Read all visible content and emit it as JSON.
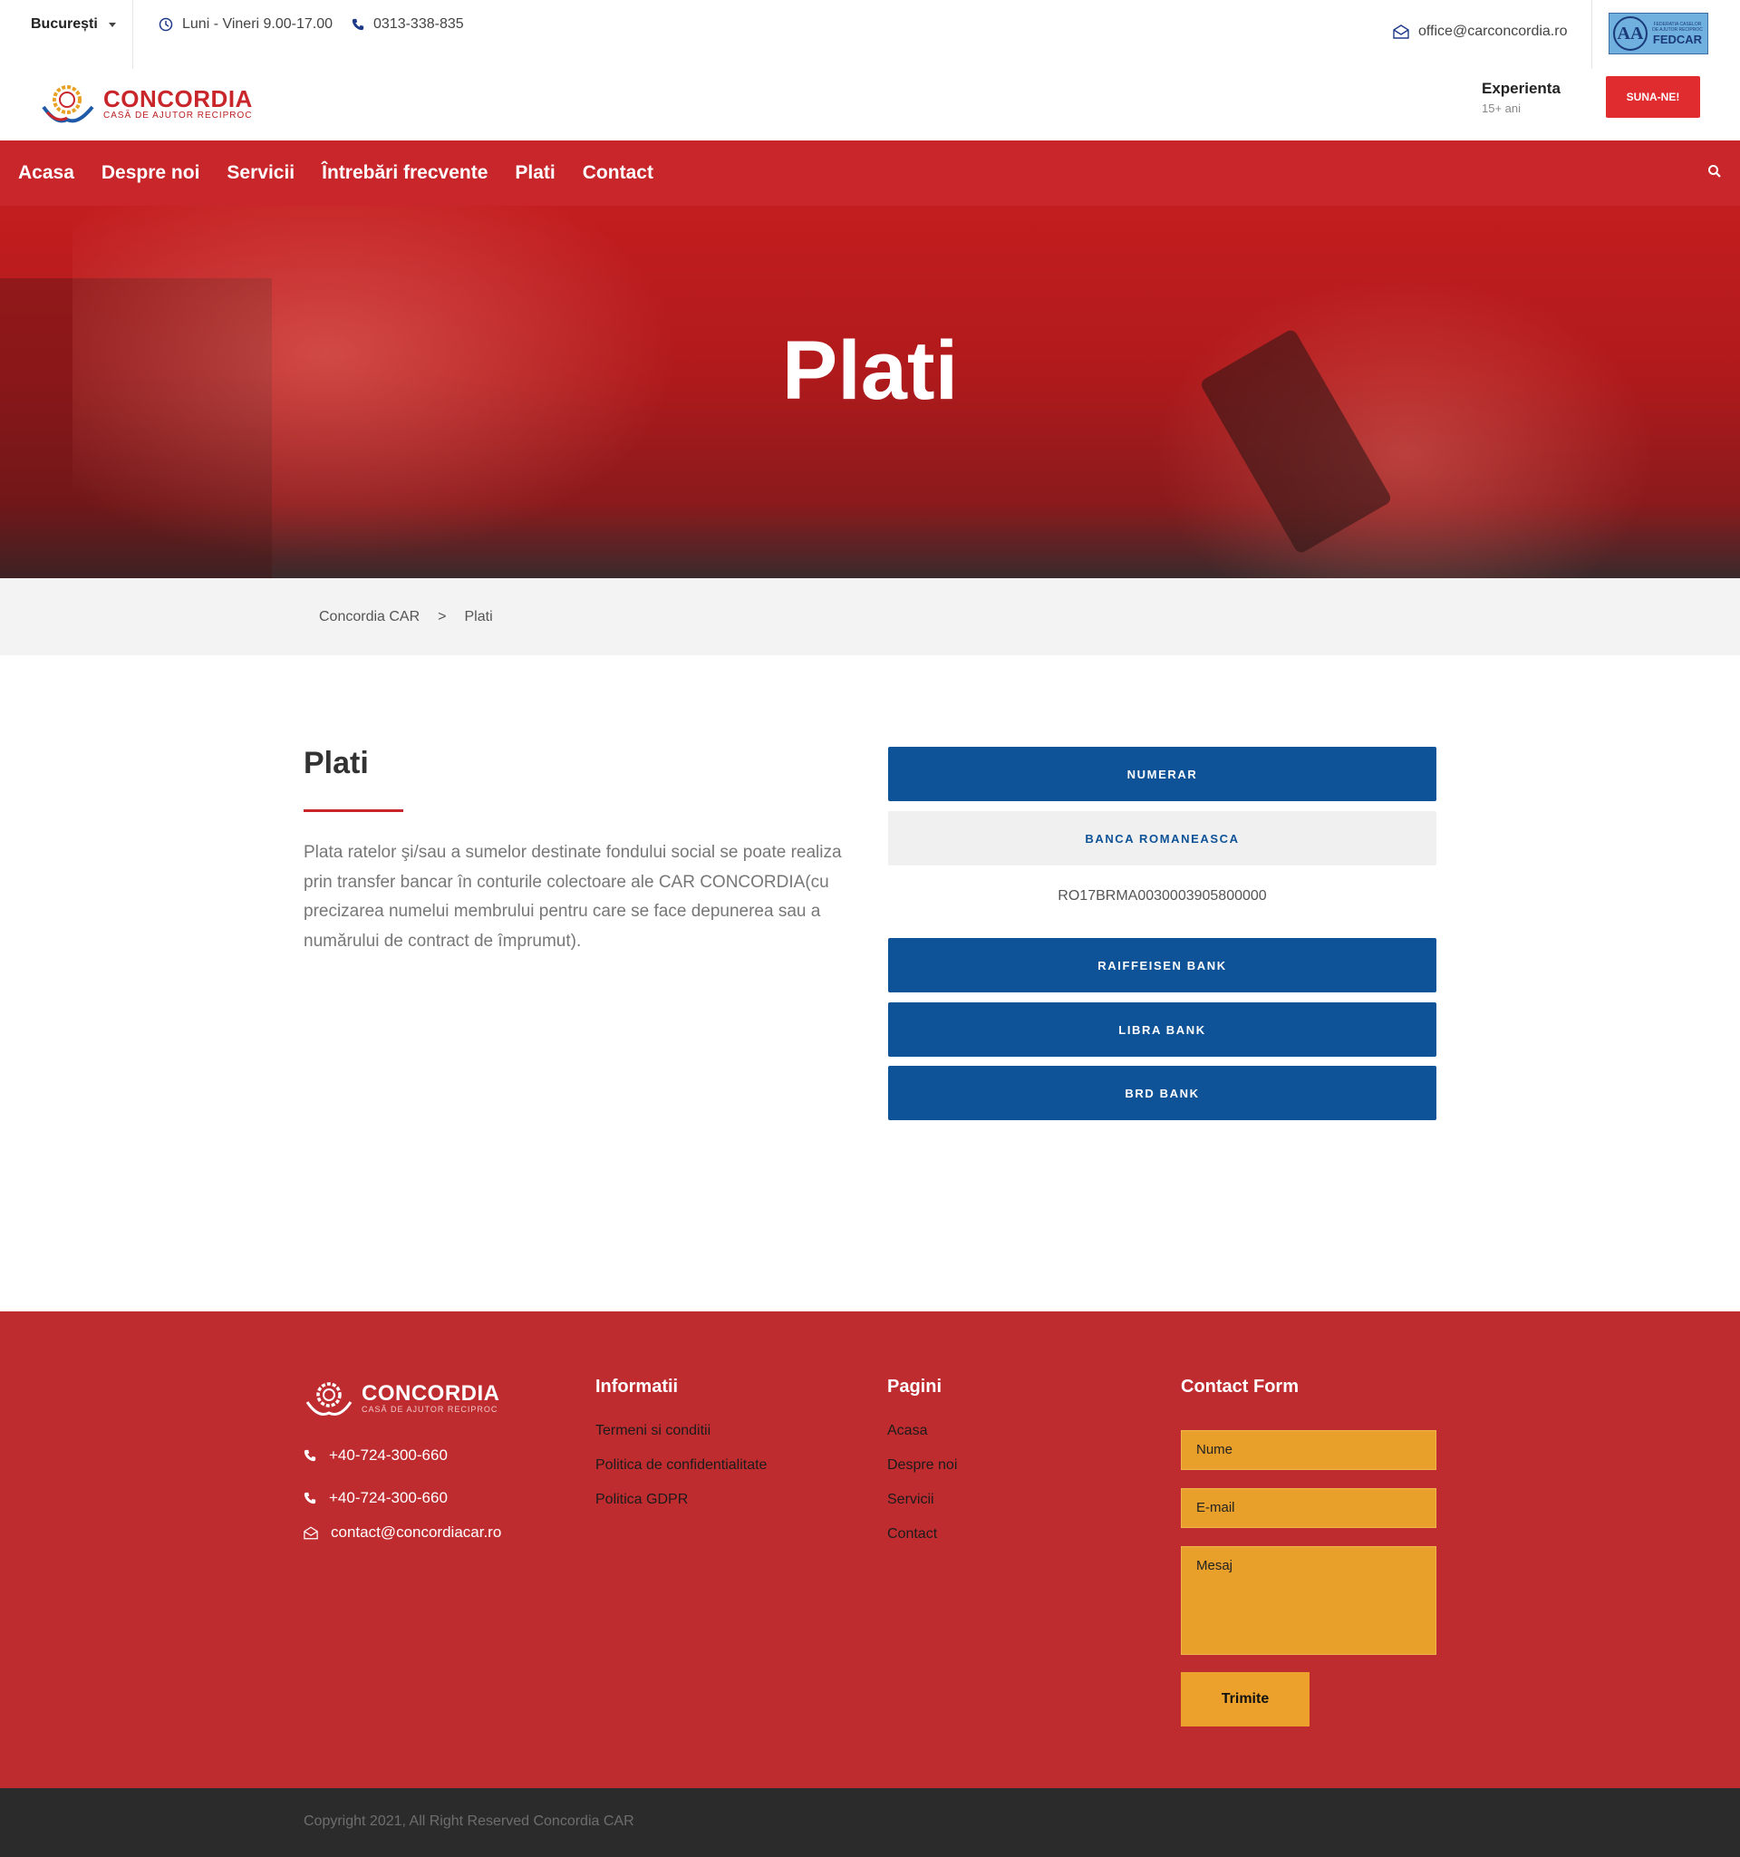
{
  "topbar": {
    "city": "București",
    "hours": "Luni - Vineri 9.00-17.00",
    "phone": "0313-338-835",
    "email": "office@carconcordia.ro",
    "badge_initials": "AA",
    "badge_small": "FEDERATIA CASELOR DE AJUTOR RECIPROC",
    "badge_name": "FEDCAR"
  },
  "header": {
    "logo_name": "CONCORDIA",
    "logo_sub": "CASĂ DE AJUTOR RECIPROC",
    "experience_title": "Experienta",
    "experience_value": "15+ ani",
    "cta": "SUNA-NE!"
  },
  "nav": {
    "items": [
      "Acasa",
      "Despre noi",
      "Servicii",
      "Întrebări frecvente",
      "Plati",
      "Contact"
    ]
  },
  "hero": {
    "title": "Plati"
  },
  "breadcrumb": {
    "home": "Concordia CAR",
    "separator": ">",
    "current": "Plati"
  },
  "content": {
    "title": "Plati",
    "text": "Plata ratelor şi/sau a sumelor destinate fondului social se poate realiza prin transfer bancar în conturile colectoare ale CAR CONCORDIA(cu precizarea numelui membrului pentru care se face depunerea sau a numărului de contract de împrumut).",
    "accordion": {
      "numerar": "NUMERAR",
      "banca_romaneasca": "BANCA ROMANEASCA",
      "iban": "RO17BRMA0030003905800000",
      "raiffeisen": "RAIFFEISEN BANK",
      "libra": "LIBRA BANK",
      "brd": "BRD BANK"
    }
  },
  "footer": {
    "logo_name": "CONCORDIA",
    "logo_sub": "CASĂ DE AJUTOR RECIPROC",
    "phone1": "+40-724-300-660",
    "phone2": "+40-724-300-660",
    "email": "contact@concordiacar.ro",
    "info_title": "Informatii",
    "info_links": [
      "Termeni si conditii",
      "Politica de confidentialitate",
      "Politica GDPR"
    ],
    "pages_title": "Pagini",
    "pages_links": [
      "Acasa",
      "Despre noi",
      "Servicii",
      "Contact"
    ],
    "form_title": "Contact Form",
    "name_placeholder": "Nume",
    "email_placeholder": "E-mail",
    "message_placeholder": "Mesaj",
    "submit": "Trimite"
  },
  "copyright": "Copyright 2021, All Right Reserved Concordia CAR",
  "colors": {
    "brand_red": "#c8262b",
    "cta_red": "#e02b2f",
    "bank_blue": "#0e5297",
    "form_orange": "#e9a02a",
    "copyright_bg": "#2b2b2b"
  }
}
